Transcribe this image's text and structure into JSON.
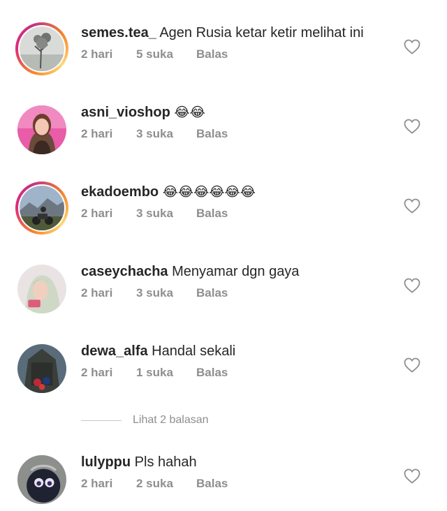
{
  "comments": [
    {
      "username": "semes.tea_",
      "text": "Agen Rusia ketar ketir melihat ini",
      "time": "2 hari",
      "likes": "5 suka",
      "reply": "Balas",
      "story_ring": true
    },
    {
      "username": "asni_vioshop",
      "text": "😂😂",
      "time": "2 hari",
      "likes": "3 suka",
      "reply": "Balas",
      "story_ring": false
    },
    {
      "username": "ekadoembo",
      "text": "😂😂😂😂😂😂",
      "time": "2 hari",
      "likes": "3 suka",
      "reply": "Balas",
      "story_ring": true
    },
    {
      "username": "caseychacha",
      "text": "Menyamar dgn gaya",
      "time": "2 hari",
      "likes": "3 suka",
      "reply": "Balas",
      "story_ring": false
    },
    {
      "username": "dewa_alfa",
      "text": "Handal sekali",
      "time": "2 hari",
      "likes": "1 suka",
      "reply": "Balas",
      "story_ring": false
    },
    {
      "username": "lulyppu",
      "text": "Pls hahah",
      "time": "2 hari",
      "likes": "2 suka",
      "reply": "Balas",
      "story_ring": false
    }
  ],
  "view_replies_label": "Lihat 2 balasan",
  "colors": {
    "text": "#262626",
    "muted": "#8e8e8e",
    "ring_gradient": [
      "#f58529",
      "#dd2a7b",
      "#feda77"
    ]
  },
  "icons": {
    "like": "heart-outline-icon"
  }
}
